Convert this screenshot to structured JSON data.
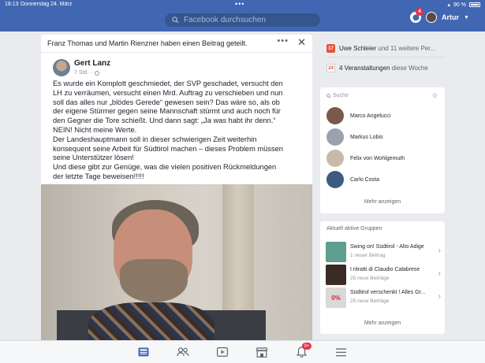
{
  "status_bar": {
    "time": "18:13",
    "date": "Donnerstag 24. März",
    "battery": "90 %"
  },
  "header": {
    "search_placeholder": "Facebook durchsuchen",
    "messenger_badge": "4",
    "user_name": "Artur",
    "brand_color": "#4267b2"
  },
  "post": {
    "shared_by": "Franz Thomas und Martin Rienzner haben einen Beitrag geteilt.",
    "author": "Gert Lanz",
    "time": "7 Std. ·",
    "text_lines": [
      "Es wurde ein Komplott geschmiedet, der SVP geschadet, versucht den",
      "LH zu verräumen, versucht einen Mrd. Auftrag zu verschieben und nun",
      "soll das alles nur „blödes Gerede“ gewesen sein? Das wäre so, als ob",
      "der eigene Stürmer gegen seine Mannschaft stürmt und auch noch für",
      "den Gegner die Tore schießt. Und dann sagt: „Ja was habt ihr denn.“",
      "NEIN! Nicht meine Werte.",
      "Der Landeshauptmann soll in dieser schwierigen Zeit weiterhin",
      "konsequent seine Arbeit für Südtirol machen – dieses Problem müssen",
      "seine Unterstützer lösen!",
      "Und diese gibt zur Genüge, was die vielen positiven Rückmeldungen",
      "der letzte Tage beweisen!!!!!"
    ]
  },
  "events": {
    "birthday_name": "Uwe Schleier",
    "birthday_rest": " und 11 weitere Per...",
    "birthday_icon_text": "17",
    "events_count": "4 Veranstaltungen",
    "events_rest": " diese Woche",
    "calendar_icon_text": "24"
  },
  "contacts": {
    "search_label": "Suche",
    "items": [
      {
        "name": "Marco Angelucci",
        "color": "#7a5a4a"
      },
      {
        "name": "Markus Lobis",
        "color": "#9aa3ad"
      },
      {
        "name": "Felix von Wohlgemuth",
        "color": "#c9b9a8"
      },
      {
        "name": "Carlo Costa",
        "color": "#3d5a80"
      }
    ],
    "more": "Mehr anzeigen"
  },
  "groups": {
    "title": "Aktuell aktive Gruppen",
    "items": [
      {
        "name": "Swing on! Südtirol - Alto Adige",
        "sub": "1 neuer Beitrag",
        "color": "#5f9e8f"
      },
      {
        "name": "I ritratti di Claudio Calabrese",
        "sub": "25 neue Beiträge",
        "color": "#3a2c24"
      },
      {
        "name": "Südtirol verschenkt ! Alles Gr...",
        "sub": "25 neue Beiträge",
        "color": "#d9d9d9",
        "thumb_text": "0%"
      }
    ],
    "more": "Mehr anzeigen"
  },
  "bottom_nav": {
    "notifications_badge": "9+"
  }
}
